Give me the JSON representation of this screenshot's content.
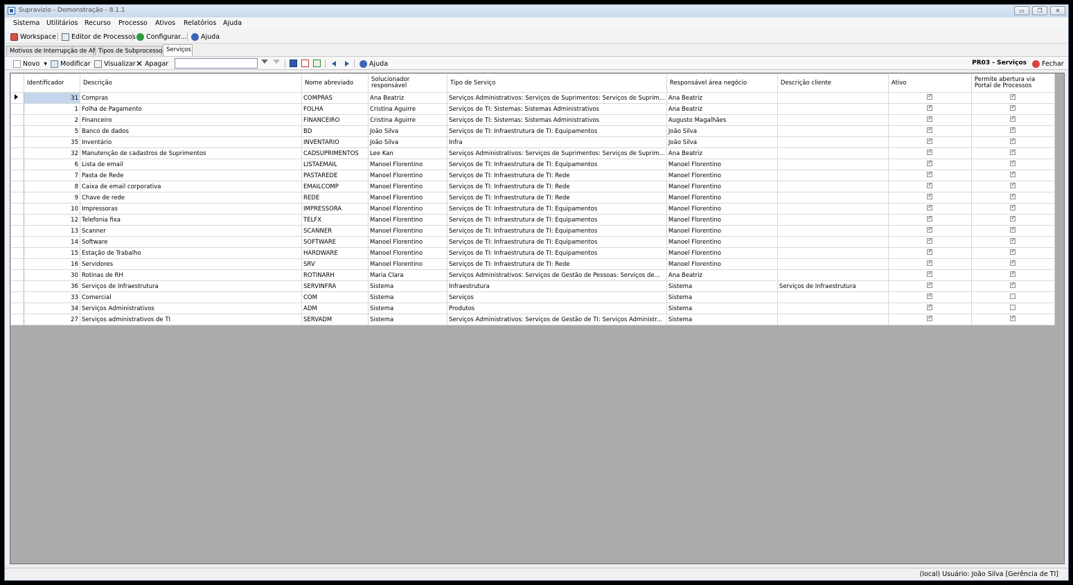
{
  "window": {
    "title": "Supravizio - Demonstração - 8.1.1",
    "controls": {
      "minimize": "▭",
      "restore": "❐",
      "close": "✕"
    }
  },
  "menu": [
    "Sistema",
    "Utilitários",
    "Recurso",
    "Processo",
    "Ativos",
    "Relatórios",
    "Ajuda"
  ],
  "toolbar": {
    "workspace": "Workspace",
    "editor": "Editor de Processos",
    "configurar": "Configurar...",
    "ajuda": "Ajuda"
  },
  "tabs": [
    "Motivos de Interrupção de ANS",
    "Tipos de Subprocessos",
    "Serviços"
  ],
  "actions": {
    "novo": "Novo",
    "modificar": "Modificar",
    "visualizar": "Visualizar",
    "apagar": "Apagar",
    "search_value": "",
    "ajuda": "Ajuda",
    "form_title": "PR03 - Serviços",
    "fechar": "Fechar"
  },
  "grid": {
    "columns": [
      "Identificador",
      "Descrição",
      "Nome abreviado",
      "Solucionador responsável",
      "Tipo de Serviço",
      "Responsável área negócio",
      "Descrição cliente",
      "Ativo",
      "Permite abertura via Portal de Processos"
    ],
    "rows": [
      {
        "id": "31",
        "desc": "Compras",
        "nome": "COMPRAS",
        "sol": "Ana Beatriz",
        "tipo": "Serviços Administrativos: Serviços de Suprimentos: Serviços de Suprim...",
        "resp": "Ana Beatriz",
        "cli": "",
        "ativo": true,
        "portal": true
      },
      {
        "id": "1",
        "desc": "Folha de Pagamento",
        "nome": "FOLHA",
        "sol": "Cristina Aguirre",
        "tipo": "Serviços de TI: Sistemas: Sistemas Administrativos",
        "resp": "Ana Beatriz",
        "cli": "",
        "ativo": true,
        "portal": true
      },
      {
        "id": "2",
        "desc": "Financeiro",
        "nome": "FINANCEIRO",
        "sol": "Cristina Aguirre",
        "tipo": "Serviços de TI: Sistemas: Sistemas Administrativos",
        "resp": "Augusto Magalhães",
        "cli": "",
        "ativo": true,
        "portal": true
      },
      {
        "id": "5",
        "desc": "Banco de dados",
        "nome": "BD",
        "sol": "João Silva",
        "tipo": "Serviços de TI: Infraestrutura de TI: Equipamentos",
        "resp": "João Silva",
        "cli": "",
        "ativo": true,
        "portal": true
      },
      {
        "id": "35",
        "desc": "Inventário",
        "nome": "INVENTARIO",
        "sol": "João Silva",
        "tipo": "Infra",
        "resp": "João Silva",
        "cli": "",
        "ativo": true,
        "portal": true
      },
      {
        "id": "32",
        "desc": "Manutenção de cadastros de Suprimentos",
        "nome": "CADSUPRIMENTOS",
        "sol": "Lee Kan",
        "tipo": "Serviços Administrativos: Serviços de Suprimentos: Serviços de Suprim...",
        "resp": "Ana Beatriz",
        "cli": "",
        "ativo": true,
        "portal": true
      },
      {
        "id": "6",
        "desc": "Lista de email",
        "nome": "LISTAEMAIL",
        "sol": "Manoel Florentino",
        "tipo": "Serviços de TI: Infraestrutura de TI: Equipamentos",
        "resp": "Manoel Florentino",
        "cli": "",
        "ativo": true,
        "portal": true
      },
      {
        "id": "7",
        "desc": "Pasta de Rede",
        "nome": "PASTAREDE",
        "sol": "Manoel Florentino",
        "tipo": "Serviços de TI: Infraestrutura de TI: Rede",
        "resp": "Manoel Florentino",
        "cli": "",
        "ativo": true,
        "portal": true
      },
      {
        "id": "8",
        "desc": "Caixa de email corporativa",
        "nome": "EMAILCOMP",
        "sol": "Manoel Florentino",
        "tipo": "Serviços de TI: Infraestrutura de TI: Rede",
        "resp": "Manoel Florentino",
        "cli": "",
        "ativo": true,
        "portal": true
      },
      {
        "id": "9",
        "desc": "Chave de rede",
        "nome": "REDE",
        "sol": "Manoel Florentino",
        "tipo": "Serviços de TI: Infraestrutura de TI: Rede",
        "resp": "Manoel Florentino",
        "cli": "",
        "ativo": true,
        "portal": true
      },
      {
        "id": "10",
        "desc": "Impressoras",
        "nome": "IMPRESSORA",
        "sol": "Manoel Florentino",
        "tipo": "Serviços de TI: Infraestrutura de TI: Equipamentos",
        "resp": "Manoel Florentino",
        "cli": "",
        "ativo": true,
        "portal": true
      },
      {
        "id": "12",
        "desc": "Telefonia fixa",
        "nome": "TELFX",
        "sol": "Manoel Florentino",
        "tipo": "Serviços de TI: Infraestrutura de TI: Equipamentos",
        "resp": "Manoel Florentino",
        "cli": "",
        "ativo": true,
        "portal": true
      },
      {
        "id": "13",
        "desc": "Scanner",
        "nome": "SCANNER",
        "sol": "Manoel Florentino",
        "tipo": "Serviços de TI: Infraestrutura de TI: Equipamentos",
        "resp": "Manoel Florentino",
        "cli": "",
        "ativo": true,
        "portal": true
      },
      {
        "id": "14",
        "desc": "Software",
        "nome": "SOFTWARE",
        "sol": "Manoel Florentino",
        "tipo": "Serviços de TI: Infraestrutura de TI: Equipamentos",
        "resp": "Manoel Florentino",
        "cli": "",
        "ativo": true,
        "portal": true
      },
      {
        "id": "15",
        "desc": "Estação de Trabalho",
        "nome": "HARDWARE",
        "sol": "Manoel Florentino",
        "tipo": "Serviços de TI: Infraestrutura de TI: Equipamentos",
        "resp": "Manoel Florentino",
        "cli": "",
        "ativo": true,
        "portal": true
      },
      {
        "id": "16",
        "desc": "Servidores",
        "nome": "SRV",
        "sol": "Manoel Florentino",
        "tipo": "Serviços de TI: Infraestrutura de TI: Rede",
        "resp": "Manoel Florentino",
        "cli": "",
        "ativo": true,
        "portal": true
      },
      {
        "id": "30",
        "desc": "Rotinas de RH",
        "nome": "ROTINARH",
        "sol": "Maria Clara",
        "tipo": "Serviços Administrativos: Serviços de Gestão de Pessoas: Serviços de...",
        "resp": "Ana Beatriz",
        "cli": "",
        "ativo": true,
        "portal": true
      },
      {
        "id": "36",
        "desc": "Serviços de Infraestrutura",
        "nome": "SERVINFRA",
        "sol": "Sistema",
        "tipo": "Infraestrutura",
        "resp": "Sistema",
        "cli": "Serviços de Infraestrutura",
        "ativo": true,
        "portal": true
      },
      {
        "id": "33",
        "desc": "Comercial",
        "nome": "COM",
        "sol": "Sistema",
        "tipo": "Serviços",
        "resp": "Sistema",
        "cli": "",
        "ativo": true,
        "portal": false
      },
      {
        "id": "34",
        "desc": "Serviços Administrativos",
        "nome": "ADM",
        "sol": "Sistema",
        "tipo": "Produtos",
        "resp": "Sistema",
        "cli": "",
        "ativo": true,
        "portal": false
      },
      {
        "id": "27",
        "desc": "Serviços administrativos de TI",
        "nome": "SERVADM",
        "sol": "Sistema",
        "tipo": "Serviços Administrativos: Serviços de Gestão de TI: Serviços Administr...",
        "resp": "Sistema",
        "cli": "",
        "ativo": true,
        "portal": true
      }
    ]
  },
  "status": "(local)  Usuário: João Silva [Gerência de TI]"
}
